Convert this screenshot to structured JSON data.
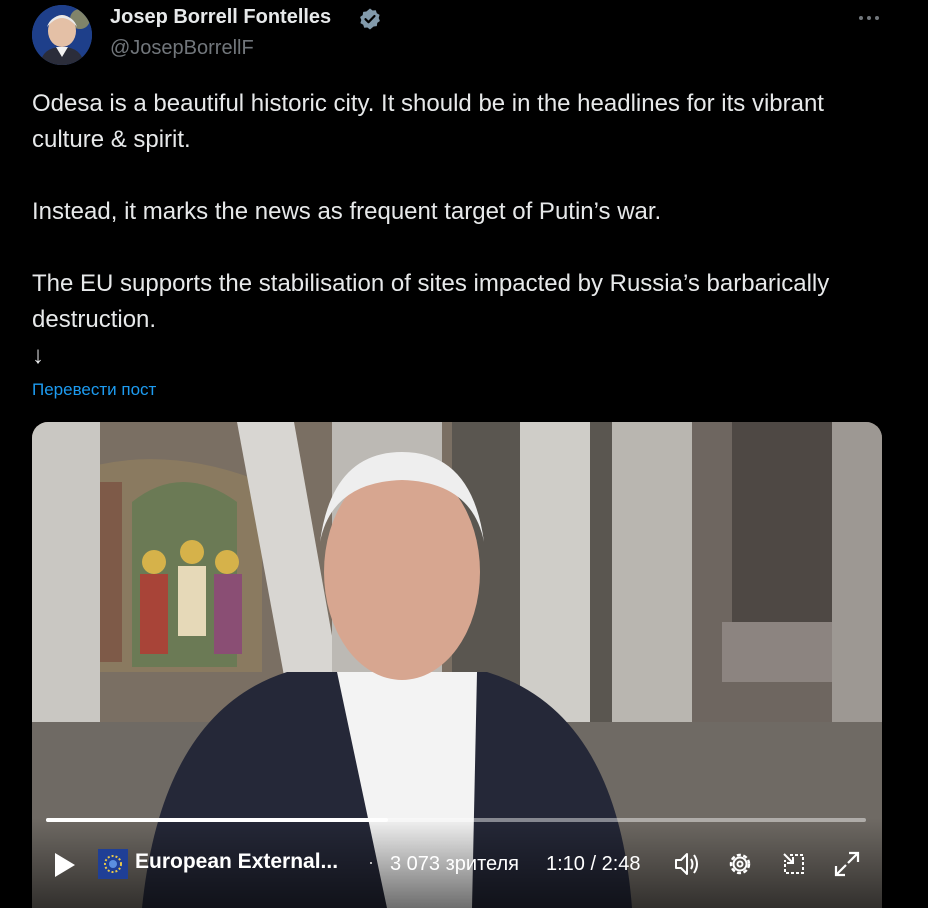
{
  "author": {
    "name": "Josep Borrell Fontelles",
    "handle": "@JosepBorrellF",
    "verified_color": "#829aab"
  },
  "menu": {
    "icon": "more-icon"
  },
  "tweet": {
    "p1": "Odesa is a beautiful historic city. It should be in the headlines for its vibrant culture & spirit.",
    "p2": "Instead, it marks the news as frequent target of Putin’s war.",
    "p3": "The EU supports the stabilisation of sites impacted by Russia’s barbarically destruction.",
    "arrow": "↓"
  },
  "translate_link": "Перевести пост",
  "video": {
    "channel": "European External...",
    "separator": "·",
    "viewers": "3 073 зрителя",
    "time": "1:10 / 2:48",
    "progress": 0.417,
    "accent": "#1d9bf0"
  }
}
